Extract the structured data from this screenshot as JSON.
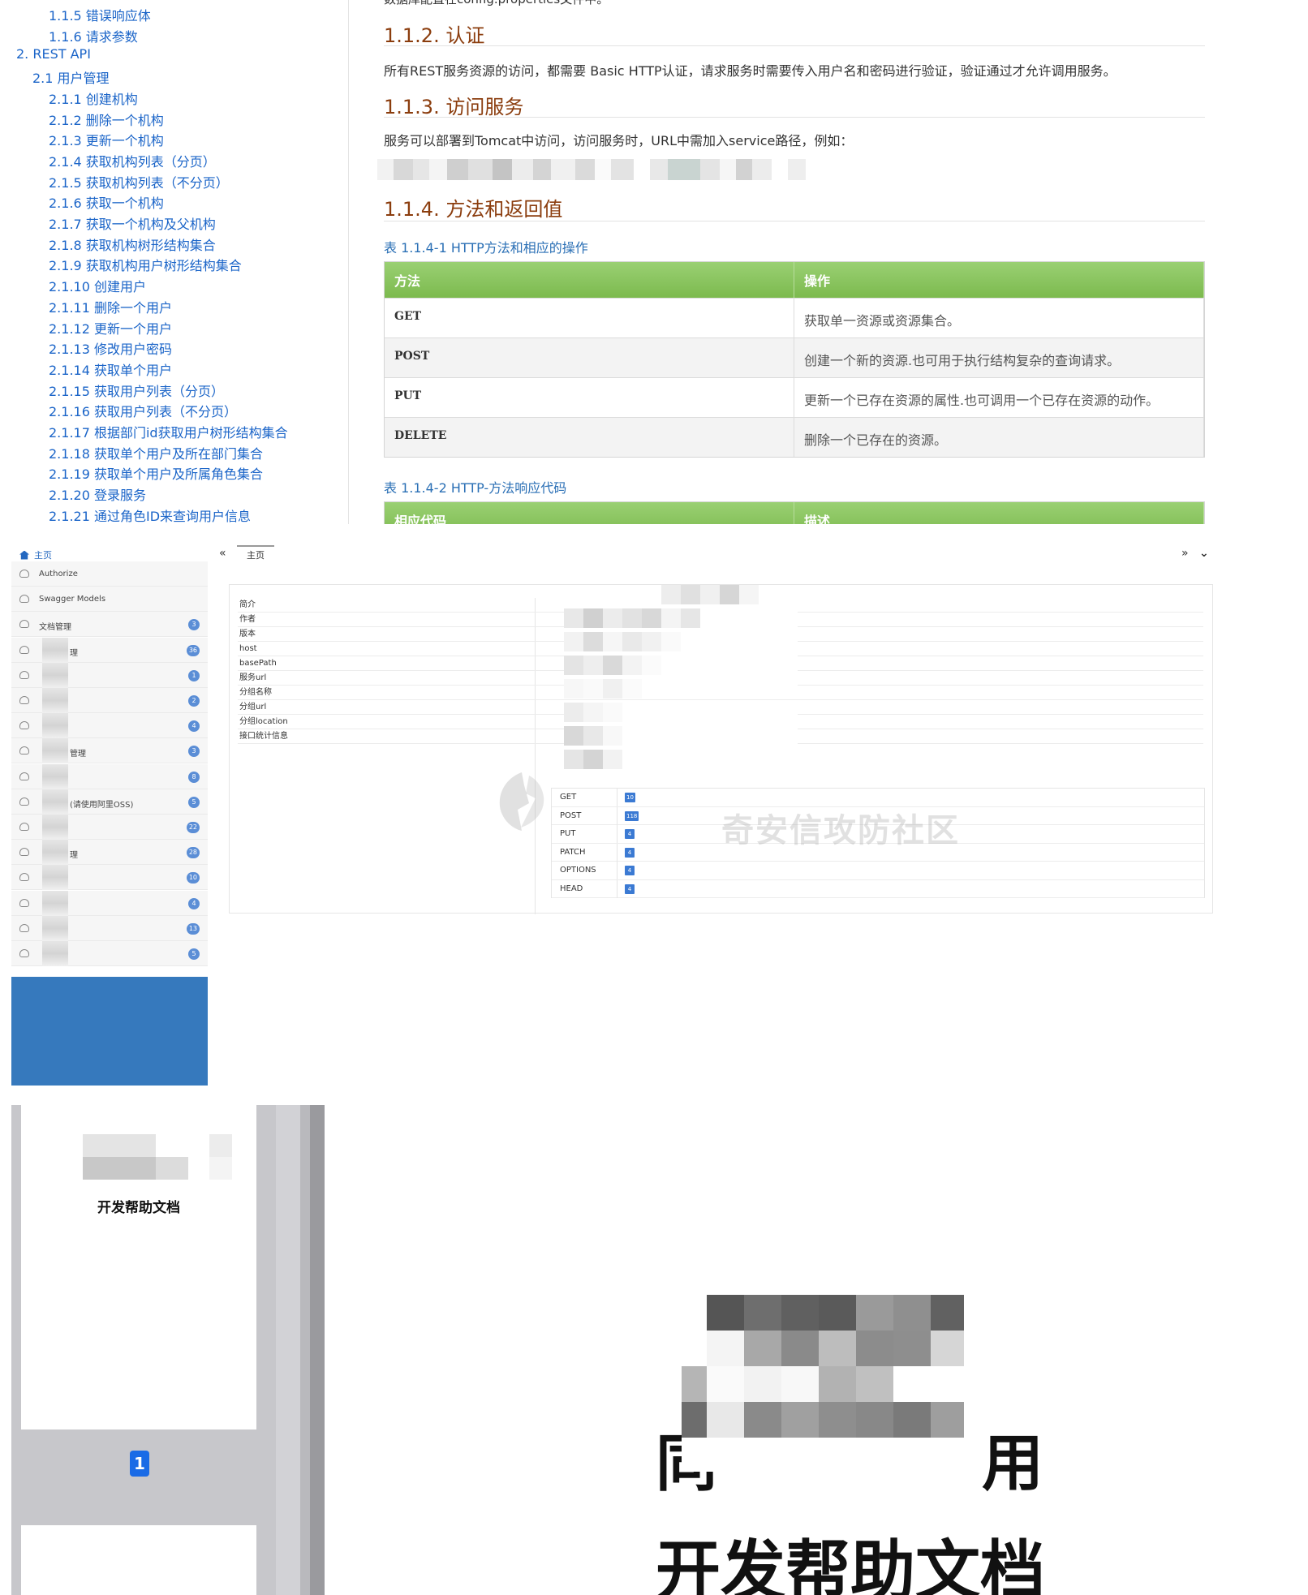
{
  "doc": {
    "top_line_fragment": "数据库配置在config.properties文件中。",
    "toc": [
      {
        "level": 3,
        "text": "1.1.5 错误响应体"
      },
      {
        "level": 3,
        "text": "1.1.6 请求参数"
      },
      {
        "level": 1,
        "text": "2. REST API"
      },
      {
        "level": 2,
        "text": "2.1 用户管理"
      },
      {
        "level": 3,
        "text": "2.1.1 创建机构"
      },
      {
        "level": 3,
        "text": "2.1.2 删除一个机构"
      },
      {
        "level": 3,
        "text": "2.1.3 更新一个机构"
      },
      {
        "level": 3,
        "text": "2.1.4 获取机构列表（分页）"
      },
      {
        "level": 3,
        "text": "2.1.5 获取机构列表（不分页）"
      },
      {
        "level": 3,
        "text": "2.1.6 获取一个机构"
      },
      {
        "level": 3,
        "text": "2.1.7 获取一个机构及父机构"
      },
      {
        "level": 3,
        "text": "2.1.8 获取机构树形结构集合"
      },
      {
        "level": 3,
        "text": "2.1.9 获取机构用户树形结构集合"
      },
      {
        "level": 3,
        "text": "2.1.10 创建用户"
      },
      {
        "level": 3,
        "text": "2.1.11 删除一个用户"
      },
      {
        "level": 3,
        "text": "2.1.12 更新一个用户"
      },
      {
        "level": 3,
        "text": "2.1.13 修改用户密码"
      },
      {
        "level": 3,
        "text": "2.1.14 获取单个用户"
      },
      {
        "level": 3,
        "text": "2.1.15 获取用户列表（分页）"
      },
      {
        "level": 3,
        "text": "2.1.16 获取用户列表（不分页）"
      },
      {
        "level": 3,
        "text": "2.1.17 根据部门id获取用户树形结构集合"
      },
      {
        "level": 3,
        "text": "2.1.18 获取单个用户及所在部门集合"
      },
      {
        "level": 3,
        "text": "2.1.19 获取单个用户及所属角色集合"
      },
      {
        "level": 3,
        "text": "2.1.20 登录服务"
      },
      {
        "level": 3,
        "text": "2.1.21 通过角色ID来查询用户信息"
      }
    ],
    "sections": {
      "auth_title": "1.1.2. 认证",
      "auth_text": "所有REST服务资源的访问，都需要 Basic HTTP认证，请求服务时需要传入用户名和密码进行验证，验证通过才允许调用服务。",
      "access_title": "1.1.3. 访问服务",
      "access_text": "服务可以部署到Tomcat中访问，访问服务时，URL中需加入service路径，例如：",
      "methods_title": "1.1.4. 方法和返回值"
    },
    "table1": {
      "caption": "表 1.1.4-1 HTTP方法和相应的操作",
      "headers": [
        "方法",
        "操作"
      ],
      "rows": [
        [
          "GET",
          "获取单一资源或资源集合。"
        ],
        [
          "POST",
          "创建一个新的资源.也可用于执行结构复杂的查询请求。"
        ],
        [
          "PUT",
          "更新一个已存在资源的属性.也可调用一个已存在资源的动作。"
        ],
        [
          "DELETE",
          "删除一个已存在的资源。"
        ]
      ]
    },
    "table2": {
      "caption": "表 1.1.4-2 HTTP-方法响应代码",
      "headers": [
        "相应代码",
        "描述"
      ]
    }
  },
  "swagger": {
    "home_label": "主页",
    "tab_label": "主页",
    "nav_left_arrow": "«",
    "nav_right_arrow": "»",
    "nav_collapse": "⌄",
    "nav_items": [
      {
        "label": "Authorize",
        "badge": ""
      },
      {
        "label": "Swagger Models",
        "badge": ""
      },
      {
        "label": "文档管理",
        "badge": "3"
      },
      {
        "label": "理",
        "badge": "36"
      },
      {
        "label": "",
        "badge": "1"
      },
      {
        "label": "",
        "badge": "2"
      },
      {
        "label": "",
        "badge": "4"
      },
      {
        "label": "管理",
        "badge": "3"
      },
      {
        "label": "",
        "badge": "8"
      },
      {
        "label": "(请使用阿里OSS)",
        "badge": "5"
      },
      {
        "label": "",
        "badge": "22"
      },
      {
        "label": "理",
        "badge": "28"
      },
      {
        "label": "",
        "badge": "10"
      },
      {
        "label": "",
        "badge": "4"
      },
      {
        "label": "",
        "badge": "13"
      },
      {
        "label": "",
        "badge": "5"
      }
    ],
    "info_rows": [
      "简介",
      "作者",
      "版本",
      "host",
      "basePath",
      "服务url",
      "分组名称",
      "分组url",
      "分组location",
      "接口统计信息"
    ],
    "methods": [
      {
        "method": "GET",
        "count": "10"
      },
      {
        "method": "POST",
        "count": "118"
      },
      {
        "method": "PUT",
        "count": "4"
      },
      {
        "method": "PATCH",
        "count": "4"
      },
      {
        "method": "OPTIONS",
        "count": "4"
      },
      {
        "method": "HEAD",
        "count": "4"
      }
    ],
    "watermark": "奇安信攻防社区"
  },
  "cover": {
    "thumb_title": "开发帮助文档",
    "page_number": "1",
    "line1_left": "同",
    "line1_right": "用",
    "line2": "开发帮助文档"
  }
}
